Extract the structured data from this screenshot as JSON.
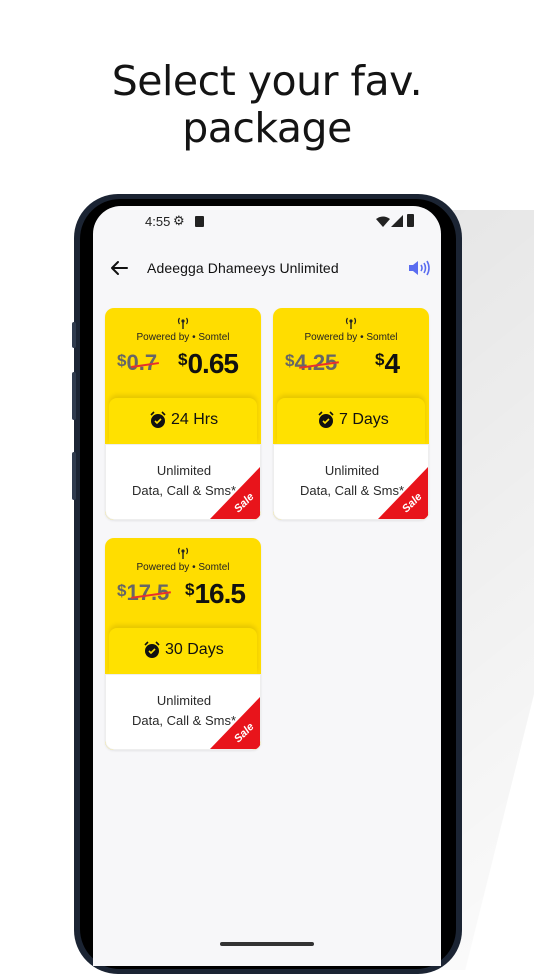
{
  "promo": {
    "line1": "Select your fav.",
    "line2": "package"
  },
  "status_bar": {
    "time": "4:55",
    "icons": [
      "gear-icon",
      "sim-icon",
      "wifi-icon",
      "signal-icon",
      "battery-icon"
    ]
  },
  "app_bar": {
    "title": "Adeegga Dhameeys Unlimited",
    "back_icon": "arrow-left-icon",
    "speaker_icon": "speaker-wave-icon"
  },
  "packages": [
    {
      "powered_by": "Powered by • Somtel",
      "currency": "$",
      "old_price": "0.7",
      "new_price": "0.65",
      "duration": "24 Hrs",
      "desc_line1": "Unlimited",
      "desc_line2": "Data, Call & Sms*",
      "badge": "Sale"
    },
    {
      "powered_by": "Powered by • Somtel",
      "currency": "$",
      "old_price": "4.25",
      "new_price": "4",
      "duration": "7 Days",
      "desc_line1": "Unlimited",
      "desc_line2": "Data, Call & Sms*",
      "badge": "Sale"
    },
    {
      "powered_by": "Powered by • Somtel",
      "currency": "$",
      "old_price": "17.5",
      "new_price": "16.5",
      "duration": "30 Days",
      "desc_line1": "Unlimited",
      "desc_line2": "Data, Call & Sms*",
      "badge": "Sale"
    }
  ],
  "colors": {
    "card_yellow": "#ffdd00",
    "sale_red": "#e8141b",
    "strike_red": "#e8302d",
    "speaker_blue": "#5a6cf0"
  }
}
